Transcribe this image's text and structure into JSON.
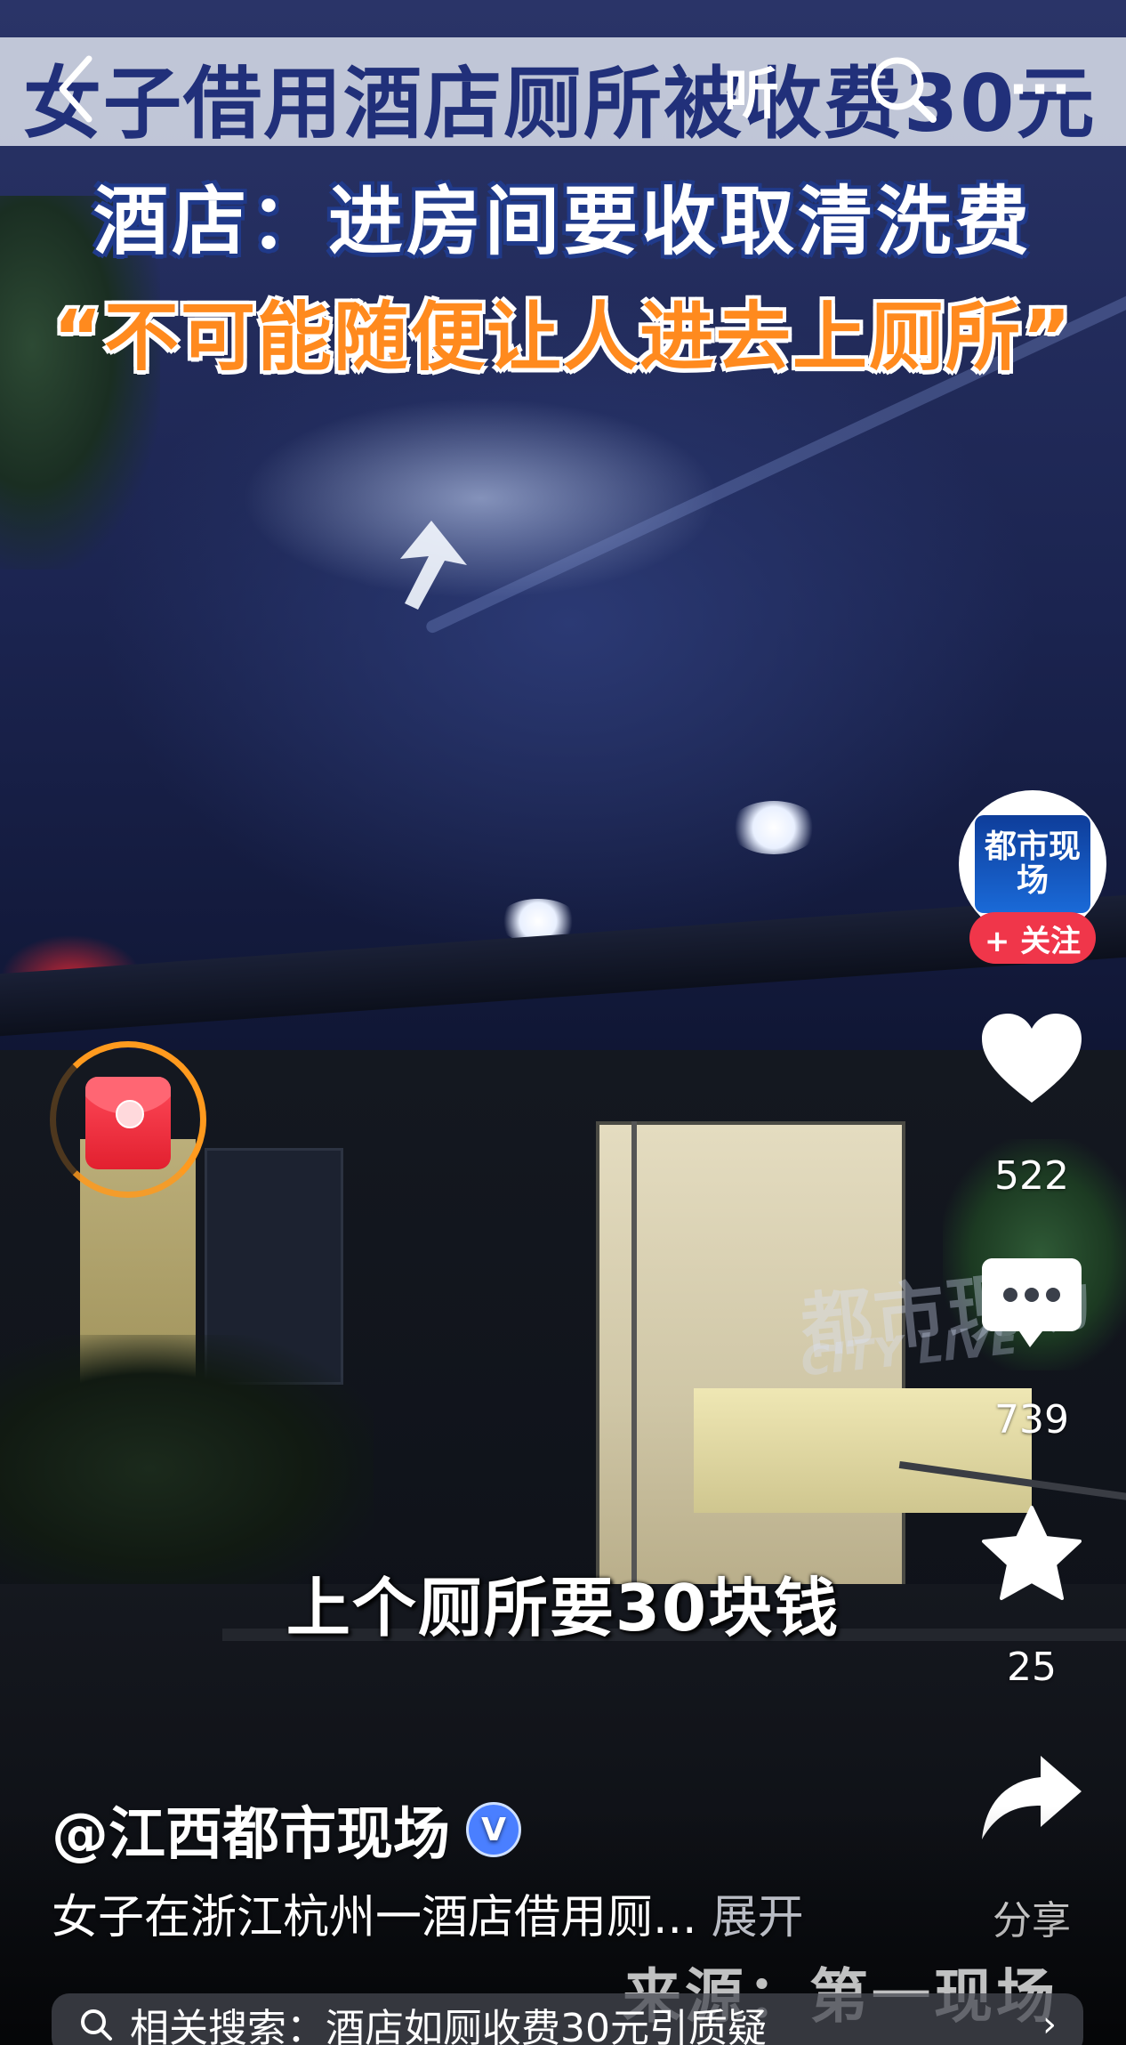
{
  "video": {
    "headline": "女子借用酒店厕所被收费30元",
    "subheadline": "酒店：进房间要收取清洗费",
    "quote": "“不可能随便让人进去上厕所”",
    "subtitle": "上个厕所要30块钱",
    "watermark": "都市现场",
    "watermark_sub": "CITY LIVE",
    "source": "来源：第一现场"
  },
  "topbar": {
    "listen_label": "听",
    "more_label": "···",
    "icons": [
      "back-arrow-icon",
      "search-icon",
      "more-icon"
    ]
  },
  "sidebar": {
    "avatar_text": "都市现场",
    "follow_label": "+ 关注",
    "like_count": "522",
    "comment_count": "739",
    "favorite_count": "25",
    "share_label": "分享",
    "icons": [
      "heart-icon",
      "comment-icon",
      "star-icon",
      "share-icon"
    ],
    "accent_color": "#f0364a"
  },
  "author": {
    "name": "@江西都市现场",
    "verified_mark": "V"
  },
  "description": {
    "text": "女子在浙江杭州一酒店借用厕...",
    "expand_label": "展开"
  },
  "related": {
    "text": "相关搜索：酒店如厕收费30元引质疑",
    "arrow": "›"
  }
}
